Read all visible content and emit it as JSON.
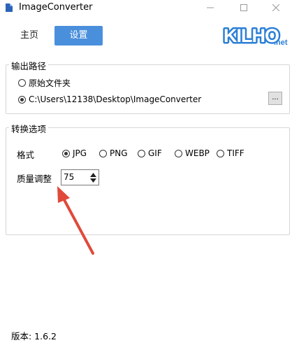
{
  "window": {
    "title": "ImageConverter"
  },
  "nav": {
    "tabs": [
      {
        "label": "主页"
      },
      {
        "label": "设置"
      }
    ]
  },
  "logo": {
    "text": "KILHO",
    "suffix": ".net"
  },
  "output_path": {
    "legend": "输出路径",
    "options": [
      {
        "label": "原始文件夹",
        "checked": false
      },
      {
        "label": "C:\\Users\\12138\\Desktop\\ImageConverter",
        "checked": true
      }
    ],
    "browse_label": "..."
  },
  "convert_options": {
    "legend": "转换选项",
    "format_label": "格式",
    "formats": [
      {
        "label": "JPG",
        "checked": true
      },
      {
        "label": "PNG",
        "checked": false
      },
      {
        "label": "GIF",
        "checked": false
      },
      {
        "label": "WEBP",
        "checked": false
      },
      {
        "label": "TIFF",
        "checked": false
      }
    ],
    "quality_label": "质量调整",
    "quality_value": "75"
  },
  "footer": {
    "version": "版本: 1.6.2"
  },
  "colors": {
    "accent": "#4a8fdc",
    "annotation_arrow": "#e04a3a",
    "logo_blue": "#2b7fd6"
  }
}
